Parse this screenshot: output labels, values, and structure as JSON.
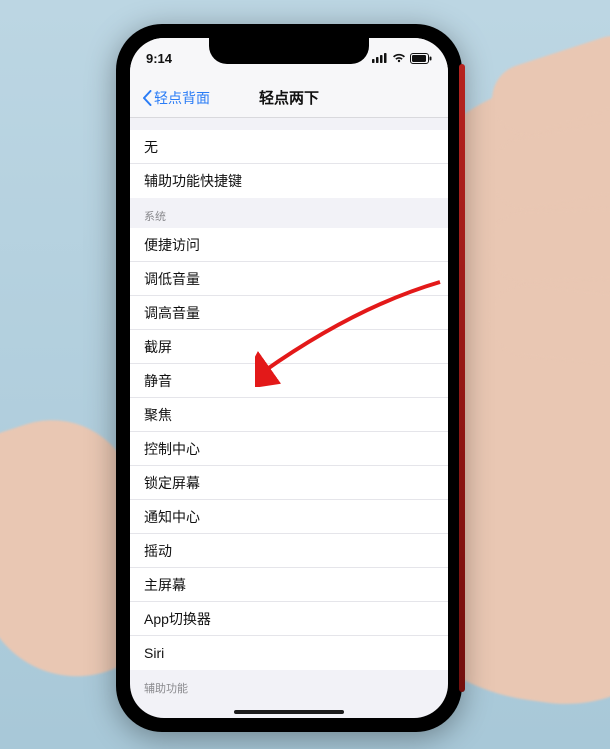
{
  "status": {
    "time": "9:14"
  },
  "nav": {
    "back_label": "轻点背面",
    "title": "轻点两下"
  },
  "group1": {
    "none": "无",
    "shortcut": "辅助功能快捷键"
  },
  "section_system_label": "系统",
  "system": [
    "便捷访问",
    "调低音量",
    "调高音量",
    "截屏",
    "静音",
    "聚焦",
    "控制中心",
    "锁定屏幕",
    "通知中心",
    "摇动",
    "主屏幕",
    "App切换器",
    "Siri"
  ],
  "section_accessibility_label": "辅助功能",
  "annotation": {
    "arrow_target": "截屏"
  }
}
